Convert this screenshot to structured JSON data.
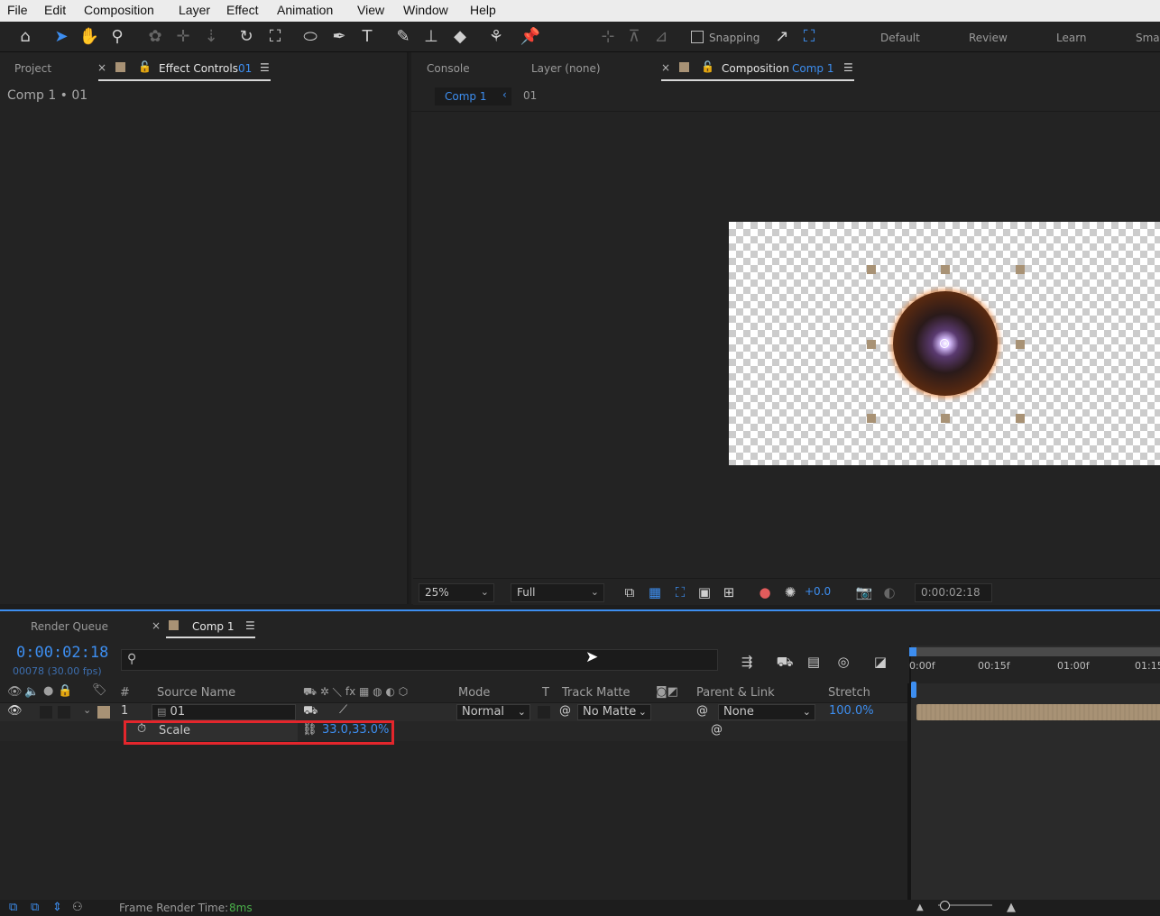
{
  "menu": [
    "File",
    "Edit",
    "Composition",
    "Layer",
    "Effect",
    "Animation",
    "View",
    "Window",
    "Help"
  ],
  "toolbar": {
    "snapping_label": "Snapping",
    "workspaces": [
      "Default",
      "Review",
      "Learn",
      "Sma"
    ]
  },
  "left_panel": {
    "tab_project": "Project",
    "tab_effect_controls": "Effect Controls",
    "tab_effect_controls_target": "01",
    "breadcrumb": "Comp 1 • 01"
  },
  "right_panel": {
    "tab_console": "Console",
    "tab_layer": "Layer (none)",
    "tab_composition": "Composition",
    "tab_composition_name": "Comp 1",
    "crumb_comp": "Comp 1",
    "crumb_layer": "01"
  },
  "viewer_bar": {
    "zoom": "25%",
    "resolution": "Full",
    "exposure": "+0.0",
    "timecode": "0:00:02:18"
  },
  "timeline": {
    "tab_render_queue": "Render Queue",
    "tab_comp": "Comp 1",
    "current_time": "0:00:02:18",
    "frame_info": "00078 (30.00 fps)",
    "columns": {
      "number": "#",
      "source_name": "Source Name",
      "mode": "Mode",
      "t": "T",
      "track_matte": "Track Matte",
      "parent_link": "Parent & Link",
      "stretch": "Stretch"
    },
    "layer": {
      "index": "1",
      "name": "01",
      "mode": "Normal",
      "track_matte": "No Matte",
      "parent": "None",
      "stretch": "100.0%"
    },
    "property": {
      "name": "Scale",
      "value": "33.0,33.0%"
    },
    "ruler": [
      "0:00f",
      "00:15f",
      "01:00f",
      "01:15"
    ],
    "status_label": "Frame Render Time:",
    "status_value": "8ms"
  },
  "colors": {
    "accent": "#3d8ef0",
    "highlight": "#e3262c",
    "label_tan": "#a89275"
  }
}
